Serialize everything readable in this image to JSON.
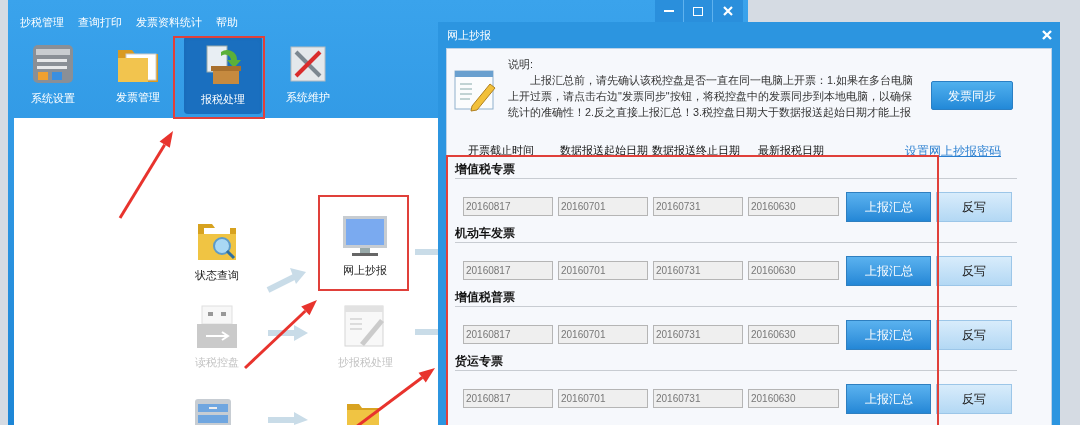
{
  "main_window": {
    "menu": [
      "抄税管理",
      "查询打印",
      "发票资料统计",
      "帮助"
    ],
    "toolbar": [
      {
        "label": "系统设置",
        "selected": false
      },
      {
        "label": "发票管理",
        "selected": false
      },
      {
        "label": "报税处理",
        "selected": true
      },
      {
        "label": "系统维护",
        "selected": false
      }
    ],
    "flow_items": [
      {
        "label": "状态查询",
        "disabled": false
      },
      {
        "label": "网上抄报",
        "disabled": false
      },
      {
        "label": "读税控盘",
        "disabled": true
      },
      {
        "label": "抄报税处理",
        "disabled": true
      }
    ]
  },
  "dialog": {
    "title": "网上抄报",
    "note_label": "说明:",
    "note_lines": [
      "上报汇总前，请先确认该税控盘是否一直在同一电脑上开票：1.如果在多台电脑",
      "上开过票，请点击右边\"发票同步\"按钮，将税控盘中的发票同步到本地电脑，以确保",
      "统计的准确性！2.反之直接上报汇总！3.税控盘日期大于数据报送起始日期才能上报"
    ],
    "sync_button": "发票同步",
    "columns": [
      "开票截止时间",
      "数据报送起始日期",
      "数据报送终止日期",
      "最新报税日期"
    ],
    "password_link": "设置网上抄报密码",
    "sections": [
      {
        "title": "增值税专票",
        "fields": [
          "20160817",
          "20160701",
          "20160731",
          "20160630"
        ],
        "report_button": "上报汇总",
        "writeback_button": "反写"
      },
      {
        "title": "机动车发票",
        "fields": [
          "20160817",
          "20160701",
          "20160731",
          "20160630"
        ],
        "report_button": "上报汇总",
        "writeback_button": "反写"
      },
      {
        "title": "增值税普票",
        "fields": [
          "20160817",
          "20160701",
          "20160731",
          "20160630"
        ],
        "report_button": "上报汇总",
        "writeback_button": "反写"
      },
      {
        "title": "货运专票",
        "fields": [
          "20160817",
          "20160701",
          "20160731",
          "20160630"
        ],
        "report_button": "上报汇总",
        "writeback_button": "反写"
      }
    ]
  }
}
